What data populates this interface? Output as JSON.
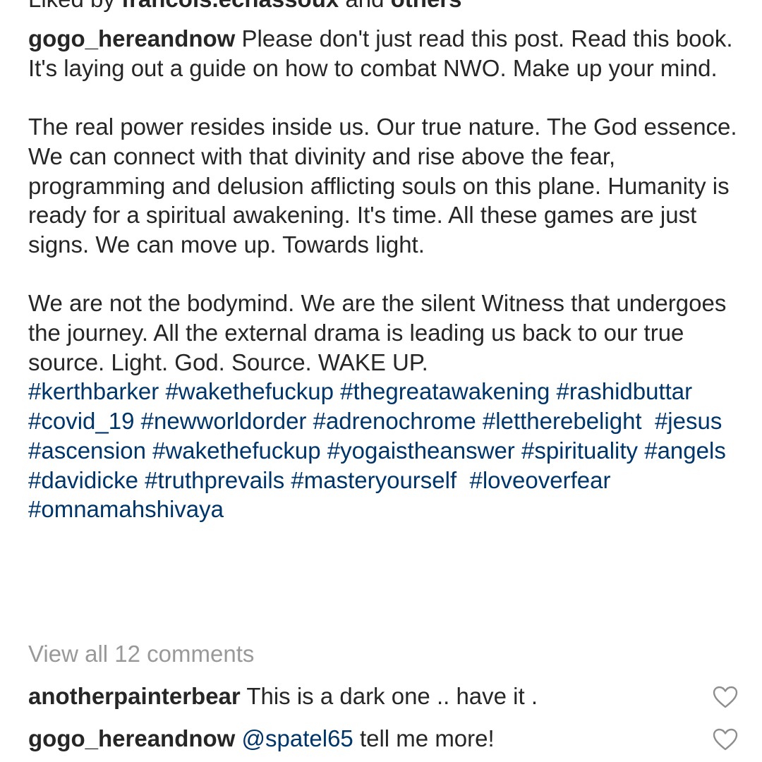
{
  "liked_by": {
    "prefix": "Liked by",
    "user": "francois.echassoux",
    "conjunction": "and",
    "others": "others"
  },
  "post": {
    "username": "gogo_hereandnow",
    "paragraph_1": "Please don't just read this post. Read this book. It's laying out a guide on how to combat NWO. Make up your mind.",
    "paragraph_2": "The real power resides inside us. Our true nature. The God essence. We can connect with that divinity and rise above the fear, programming and delusion afflicting souls on this plane. Humanity is ready for a spiritual awakening. It's time. All these games are just signs. We can move up. Towards light.",
    "paragraph_3": "We are not the bodymind. We are the silent Witness that undergoes the journey. All the external drama is leading us back to our true source. Light. God. Source. WAKE UP.",
    "hashtags": [
      "#kerthbarker",
      "#wakethefuckup",
      "#thegreatawakening",
      "#rashidbuttar",
      "#covid_19",
      "#newworldorder",
      "#adrenochrome",
      "#lettherebelight",
      "#jesus",
      "#ascension",
      "#wakethefuckup",
      "#yogaistheanswer",
      "#spirituality",
      "#angels",
      "#davidicke",
      "#truthprevails",
      "#masteryourself",
      "#loveoverfear",
      "#omnamahshivaya"
    ]
  },
  "view_all_comments": "View all 12 comments",
  "comments": [
    {
      "username": "anotherpainterbear",
      "mention": "",
      "text": "This is a dark one .. have it ."
    },
    {
      "username": "gogo_hereandnow",
      "mention": "@spatel65",
      "text": "tell me more!"
    }
  ],
  "icons": {
    "like": "heart-outline-icon"
  },
  "colors": {
    "text": "#262626",
    "link": "#003569",
    "muted": "#999999",
    "icon": "#8e8e8e"
  }
}
